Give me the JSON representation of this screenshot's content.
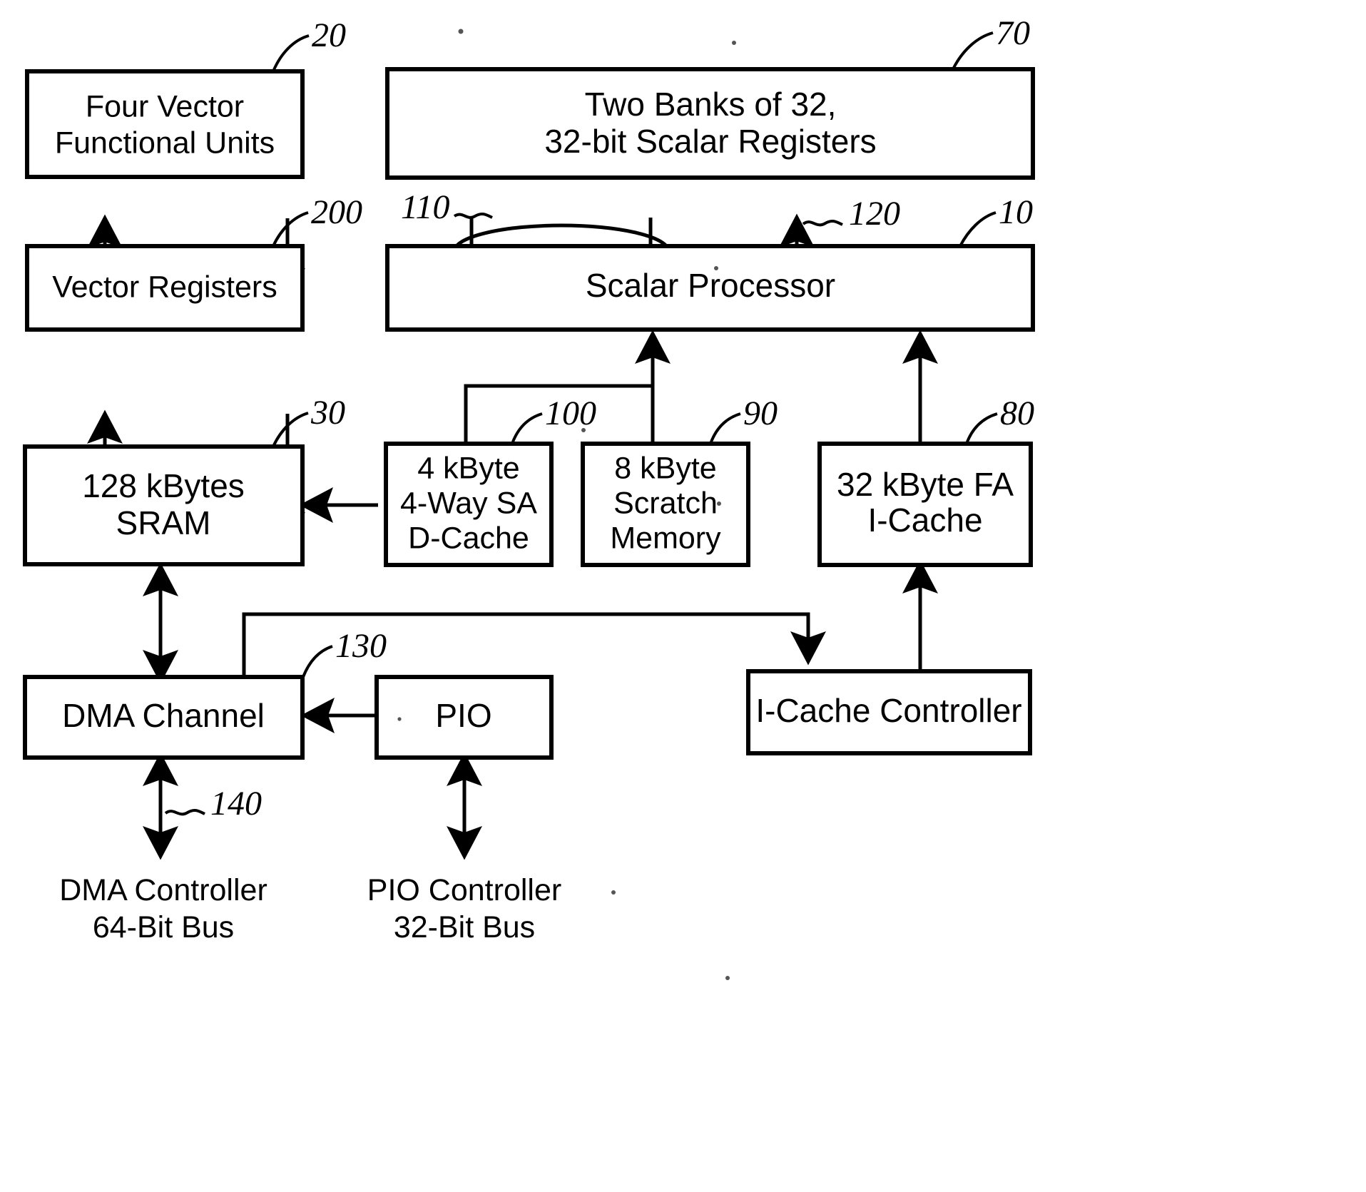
{
  "figure": {
    "kind": "patent-block-diagram",
    "background_color": "#ffffff",
    "line_color": "#000000"
  },
  "blocks": [
    {
      "id": "vfu",
      "lines": [
        "Four Vector",
        "Functional Units"
      ],
      "ref": "20"
    },
    {
      "id": "sregs",
      "lines": [
        "Two Banks of 32,",
        "32-bit Scalar Registers"
      ],
      "ref": "70"
    },
    {
      "id": "vregs",
      "lines": [
        "Vector Registers"
      ],
      "ref": "200"
    },
    {
      "id": "sproc",
      "lines": [
        "Scalar Processor"
      ],
      "ref": "10"
    },
    {
      "id": "sram",
      "lines": [
        "128 kBytes",
        "SRAM"
      ],
      "ref": "30"
    },
    {
      "id": "dcache",
      "lines": [
        "4 kByte",
        "4-Way SA",
        "D-Cache"
      ],
      "ref": "100"
    },
    {
      "id": "scratch",
      "lines": [
        "8 kByte",
        "Scratch",
        "Memory"
      ],
      "ref": "90"
    },
    {
      "id": "icache",
      "lines": [
        "32 kByte FA",
        "I-Cache"
      ],
      "ref": "80"
    },
    {
      "id": "dma",
      "lines": [
        "DMA Channel"
      ],
      "ref": "130"
    },
    {
      "id": "pio",
      "lines": [
        "PIO"
      ],
      "ref": ""
    },
    {
      "id": "icachectl",
      "lines": [
        "I-Cache Controller"
      ],
      "ref": ""
    }
  ],
  "external_labels": [
    {
      "id": "dma-bus",
      "lines": [
        "DMA Controller",
        "64-Bit Bus"
      ],
      "ref": "140"
    },
    {
      "id": "pio-bus",
      "lines": [
        "PIO Controller",
        "32-Bit Bus"
      ],
      "ref": ""
    }
  ],
  "reference_numerals": {
    "vfu": "20",
    "sregs": "70",
    "vregs": "200",
    "scalar_registers_to_processor": "110",
    "processor_to_scalar_registers": "120",
    "sproc": "10",
    "sram": "30",
    "dcache": "100",
    "scratch": "90",
    "icache": "80",
    "dma_bus_130": "130",
    "dma_bus_140": "140"
  },
  "block_text": {
    "vfu_line1": "Four Vector",
    "vfu_line2": "Functional Units",
    "sregs_line1": "Two Banks of 32,",
    "sregs_line2": "32-bit Scalar Registers",
    "vregs_line1": "Vector Registers",
    "sproc_line1": "Scalar Processor",
    "sram_line1": "128 kBytes",
    "sram_line2": "SRAM",
    "dcache_line1": "4 kByte",
    "dcache_line2": "4-Way SA",
    "dcache_line3": "D-Cache",
    "scratch_line1": "8 kByte",
    "scratch_line2": "Scratch",
    "scratch_line3": "Memory",
    "icache_line1": "32 kByte FA",
    "icache_line2": "I-Cache",
    "dma_line1": "DMA Channel",
    "pio_line1": "PIO",
    "icachectl_line1": "I-Cache Controller",
    "dma_bus_line1": "DMA Controller",
    "dma_bus_line2": "64-Bit Bus",
    "pio_bus_line1": "PIO Controller",
    "pio_bus_line2": "32-Bit Bus"
  }
}
